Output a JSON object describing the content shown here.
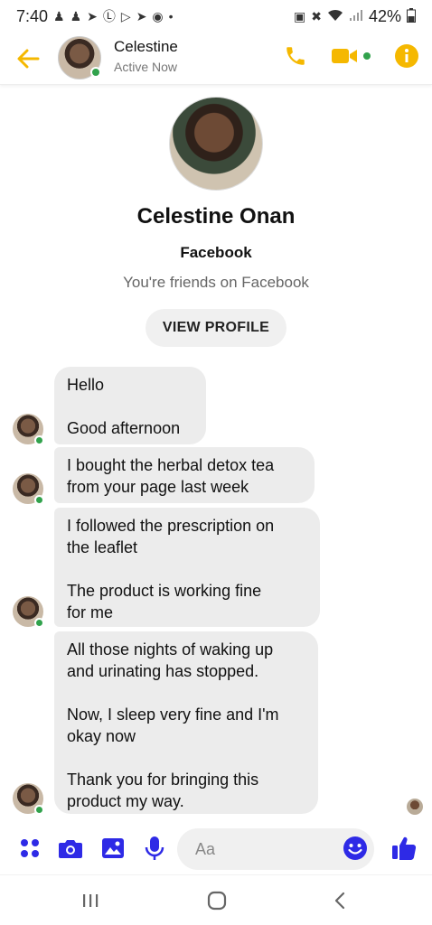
{
  "status_bar": {
    "time": "7:40",
    "battery": "42%",
    "left_icons": [
      "person-add-icon",
      "person-add-icon",
      "telegram-icon",
      "b-circle-icon",
      "play-circle-icon",
      "telegram-icon",
      "facebook-icon",
      "dot-icon"
    ],
    "right_icons": [
      "lock-icon",
      "mute-icon",
      "wifi-icon",
      "signal-icon",
      "battery-icon"
    ]
  },
  "header": {
    "name": "Celestine",
    "status": "Active Now"
  },
  "profile": {
    "full_name": "Celestine Onan",
    "source": "Facebook",
    "friends_text": "You're friends on Facebook",
    "view_profile_label": "VIEW PROFILE"
  },
  "messages": [
    {
      "text": "Hello\n\nGood afternoon"
    },
    {
      "text": "I bought the herbal detox tea\nfrom your page last week"
    },
    {
      "text": "I followed the prescription on\nthe leaflet\n\nThe product is working fine\nfor me"
    },
    {
      "text": "All those nights of waking up\nand urinating has stopped.\n\nNow, I sleep very fine and I'm\nokay now\n\nThank you for bringing this\nproduct my way."
    }
  ],
  "composer": {
    "placeholder": "Aa"
  },
  "colors": {
    "accent_yellow": "#F5B800",
    "online_green": "#31A24C",
    "composer_blue": "#2E2AE6"
  }
}
